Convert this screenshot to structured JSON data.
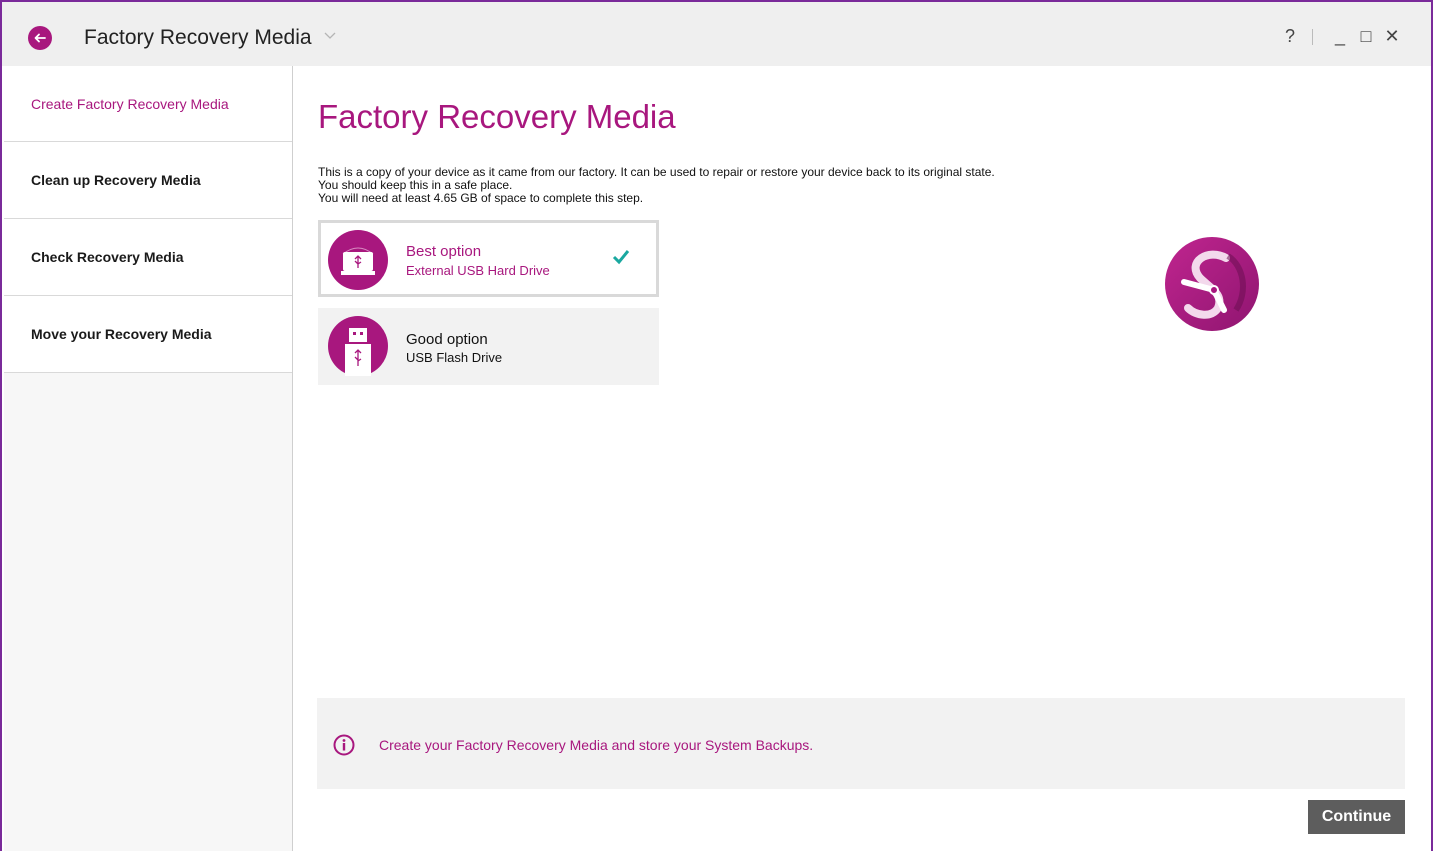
{
  "window": {
    "title": "Factory Recovery Media",
    "help_label": "?",
    "minimize_label": "_",
    "maximize_label": "□",
    "close_label": "✕",
    "back_icon": "arrow-left-icon",
    "chevron": "⌄"
  },
  "sidebar": {
    "items": [
      {
        "label": "Create Factory Recovery Media",
        "active": true
      },
      {
        "label": "Clean up Recovery Media",
        "active": false
      },
      {
        "label": "Check Recovery Media",
        "active": false
      },
      {
        "label": "Move your Recovery Media",
        "active": false
      }
    ]
  },
  "main": {
    "title": "Factory Recovery Media",
    "description": [
      "This is a copy of your device as it came from our factory. It can be used to repair or restore your device back to its original state.",
      "You should keep this in a safe place.",
      "You will need at least 4.65 GB of space to complete this step."
    ],
    "options": [
      {
        "title": "Best option",
        "subtitle": "External USB Hard Drive",
        "icon": "usb-hard-drive-icon",
        "selected": true
      },
      {
        "title": "Good option",
        "subtitle": "USB Flash Drive",
        "icon": "usb-flash-drive-icon",
        "selected": false
      }
    ],
    "info_text": "Create your Factory Recovery Media and store your System Backups.",
    "continue_label": "Continue"
  },
  "colors": {
    "accent": "#a8177e",
    "check": "#1aa8a0",
    "button": "#5d5d5d",
    "window_border": "#7a2a9a"
  }
}
